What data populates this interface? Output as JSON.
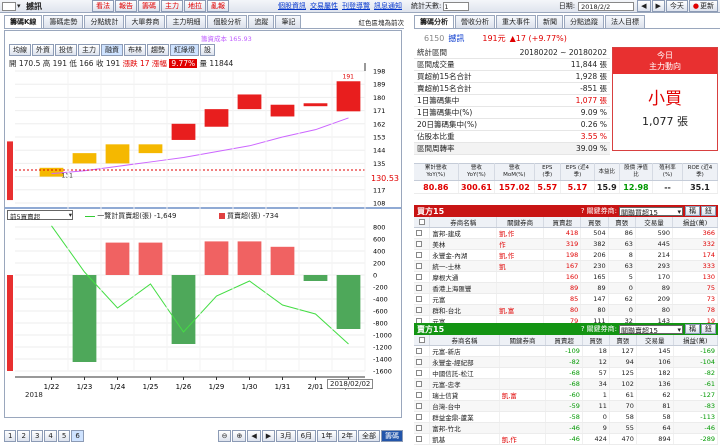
{
  "app": {
    "stock_code_input": "6150",
    "stock_name": "撼訊",
    "toolbar": [
      "看法",
      "報告",
      "籌碼",
      "主力",
      "地拉",
      "亂報"
    ],
    "toolbar_links": [
      "個股資訊",
      "交易屬性",
      "刊登導覽",
      "訊息通知"
    ]
  },
  "left_tabs": [
    "籌碼K線",
    "籌碼走勢",
    "分點統計",
    "大單券商",
    "主力明細",
    "個股分析",
    "追蹤",
    "筆記"
  ],
  "notice": "紅色區塊為前次",
  "ma_legend": "籌資成本 165.93",
  "price_tabs": [
    "均線",
    "外資",
    "投信",
    "主力",
    "融資",
    "布林",
    "趨勢",
    "紅綠燈",
    "設"
  ],
  "ohlc": {
    "open_label": "開",
    "open": "170.5",
    "high_label": "高",
    "high": "191",
    "low_label": "低",
    "low": "166",
    "close_label": "收",
    "close": "191",
    "chg_label": "漲跌",
    "chg": "17",
    "pct_label": "漲幅",
    "pct": "9.77%",
    "vol_label": "量",
    "vol": "11844"
  },
  "price_axis": [
    "198",
    "189",
    "180",
    "171",
    "162",
    "153",
    "144",
    "135",
    "126",
    "117",
    "108"
  ],
  "price_current": "130.53",
  "price_high_marker": "191",
  "price_low_marker": "131",
  "chart_data": [
    {
      "type": "candlestick",
      "title": "",
      "dates": [
        "1/22",
        "1/23",
        "1/24",
        "1/25",
        "1/26",
        "1/29",
        "1/30",
        "1/31",
        "2/01",
        "2/02"
      ],
      "open": [
        126,
        142,
        135,
        148,
        151,
        160,
        172,
        175,
        174,
        170.5
      ],
      "close": [
        132,
        135,
        148,
        142,
        162,
        172,
        182,
        167,
        176,
        191
      ],
      "cost_line": [
        128,
        130,
        133,
        136,
        139,
        143,
        147,
        153,
        158,
        166
      ],
      "ylim": [
        108,
        198
      ]
    },
    {
      "type": "bar",
      "title": "",
      "series_name_1": "一覽計買賣超(張)",
      "series_value_1": "-1,649",
      "series_name_2": "買賣超(張)",
      "series_value_2": "-734",
      "dates": [
        "1/22",
        "1/23",
        "1/24",
        "1/25",
        "1/26",
        "1/29",
        "1/30",
        "1/31",
        "2/01",
        "2/02"
      ],
      "values": [
        0,
        -1450,
        540,
        540,
        -1150,
        560,
        560,
        470,
        -100,
        -900
      ],
      "line": [
        820,
        50,
        -550,
        -150,
        -950,
        -350,
        -100,
        -500,
        -650,
        -1150
      ],
      "ylim": [
        -1600,
        900
      ]
    }
  ],
  "flow_select": "前5買賣超",
  "flow_axis": [
    "800",
    "600",
    "400",
    "200",
    "0",
    "-200",
    "-400",
    "-600",
    "-800",
    "-1000",
    "-1200",
    "-1400",
    "-1600"
  ],
  "x_year": "2018",
  "x_current": "2018/02/02",
  "bottom_pages": [
    "1",
    "2",
    "3",
    "4",
    "5",
    "6"
  ],
  "bottom_range": [
    "3月",
    "6月",
    "1年",
    "2年",
    "全部",
    "籌碼"
  ],
  "right_top": {
    "count_label": "統計天數:",
    "count_val": "1",
    "date_label": "日期:",
    "date": "2018/2/2",
    "today": "今天",
    "update": "更新"
  },
  "right_tabs": [
    "籌碼分析",
    "營收分析",
    "重大事件",
    "新聞",
    "分點追蹤",
    "法人目標"
  ],
  "stock": {
    "code": "6150",
    "name": "撼訊",
    "price": "191元",
    "chg": "▲17 (+9.77%)"
  },
  "stats": [
    {
      "label": "統計區間",
      "value": "20180202 ~ 20180202",
      "color": ""
    },
    {
      "label": "區間成交量",
      "value": "11,844 張",
      "color": ""
    },
    {
      "label": "買超前15名合計",
      "value": "1,928 張",
      "color": ""
    },
    {
      "label": "賣超前15名合計",
      "value": "-851 張",
      "color": ""
    },
    {
      "label": "1日籌碼集中",
      "value": "1,077 張",
      "color": "red"
    },
    {
      "label": "1日籌碼集中(%)",
      "value": "9.09 %",
      "color": ""
    },
    {
      "label": "20日籌碼集中(%)",
      "value": "0.26 %",
      "color": ""
    },
    {
      "label": "佔股本比重",
      "value": "3.55 %",
      "color": "red"
    },
    {
      "label": "區間周轉率",
      "value": "39.09 %",
      "color": ""
    }
  ],
  "today_box": {
    "line1": "今日",
    "line2": "主力動向",
    "action": "小買",
    "amount": "1,077 張"
  },
  "fund_headers": [
    "累計營收 YoY(%)",
    "營收 YoY(%)",
    "營收 MoM(%)",
    "EPS (季)",
    "EPS (近4季)",
    "本益比",
    "股價 淨值比",
    "殖利率 (%)",
    "ROE (近4季)"
  ],
  "fund_values": [
    "80.86",
    "300.61",
    "157.02",
    "5.57",
    "5.17",
    "15.9",
    "12.98",
    "--",
    "35.1"
  ],
  "buy_panel": {
    "title": "買方15",
    "link_label": "關鍵券商:",
    "select": "關聯買超15",
    "btn1": "稱",
    "btn2": "鈕"
  },
  "sell_panel": {
    "title": "賣方15",
    "link_label": "關鍵券商:",
    "select": "關聯賣超15",
    "btn1": "稱",
    "btn2": "鈕"
  },
  "grid_headers": [
    "券商名稱",
    "關鍵券商",
    "買賣超",
    "買張",
    "賣張",
    "交易量",
    "損益(萬)"
  ],
  "buy_rows": [
    [
      "富邦-建成",
      "凱,作",
      "418",
      "504",
      "86",
      "590",
      "366"
    ],
    [
      "美林",
      "作",
      "319",
      "382",
      "63",
      "445",
      "332"
    ],
    [
      "永豐金-內湖",
      "凱,作",
      "198",
      "206",
      "8",
      "214",
      "174"
    ],
    [
      "統一-士林",
      "凱",
      "167",
      "230",
      "63",
      "293",
      "333"
    ],
    [
      "摩根大通",
      "",
      "160",
      "165",
      "5",
      "170",
      "130"
    ],
    [
      "香港上海匯豐",
      "",
      "89",
      "89",
      "0",
      "89",
      "75"
    ],
    [
      "元富",
      "",
      "85",
      "147",
      "62",
      "209",
      "73"
    ],
    [
      "群和-台北",
      "凱,富",
      "80",
      "80",
      "0",
      "80",
      "78"
    ],
    [
      "元富",
      "",
      "79",
      "111",
      "32",
      "143",
      "19"
    ]
  ],
  "sell_rows": [
    [
      "元富-新店",
      "",
      "-109",
      "18",
      "127",
      "145",
      "-169"
    ],
    [
      "永豐金-經紀部",
      "",
      "-82",
      "12",
      "94",
      "106",
      "-104"
    ],
    [
      "中國信託-松江",
      "",
      "-68",
      "57",
      "125",
      "182",
      "-82"
    ],
    [
      "元富-忠孝",
      "",
      "-68",
      "34",
      "102",
      "136",
      "-61"
    ],
    [
      "瑞士信貸",
      "凱,富",
      "-60",
      "1",
      "61",
      "62",
      "-127"
    ],
    [
      "台灣-台中",
      "",
      "-59",
      "11",
      "70",
      "81",
      "-83"
    ],
    [
      "群益金鼎-蘆業",
      "",
      "-58",
      "0",
      "58",
      "58",
      "-113"
    ],
    [
      "富邦-竹北",
      "",
      "-46",
      "9",
      "55",
      "64",
      "-46"
    ],
    [
      "凱基",
      "凱,作",
      "-46",
      "424",
      "470",
      "894",
      "-289"
    ]
  ]
}
